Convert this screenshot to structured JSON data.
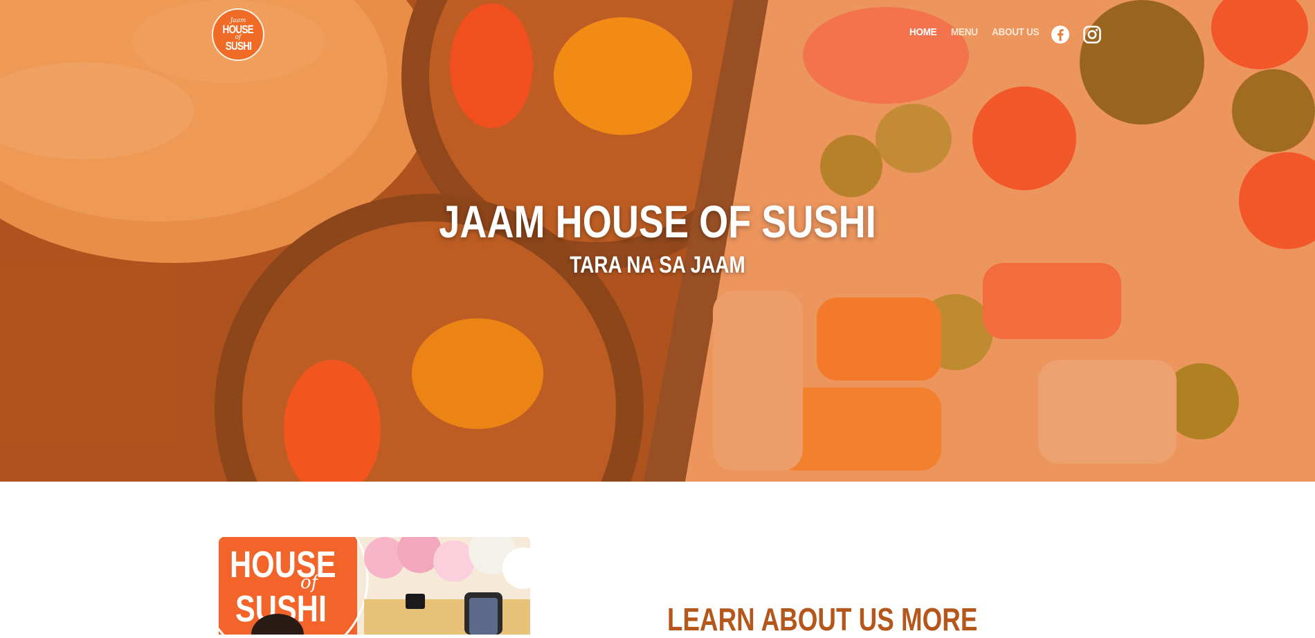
{
  "brand": {
    "logo_text_top": "Jaam",
    "logo_text_line1": "HOUSE",
    "logo_text_line2": "of",
    "logo_text_line3": "SUSHI"
  },
  "nav": {
    "items": [
      {
        "label": "HOME",
        "active": true
      },
      {
        "label": "MENU",
        "active": false
      },
      {
        "label": "ABOUT US",
        "active": false
      }
    ]
  },
  "social": {
    "icons": [
      "facebook-icon",
      "instagram-icon"
    ]
  },
  "hero": {
    "title": "JAAM HOUSE OF SUSHI",
    "subtitle": "TARA NA SA JAAM"
  },
  "about": {
    "heading": "LEARN ABOUT US MORE",
    "photo_sign_line1": "HOUSE",
    "photo_sign_line2": "of",
    "photo_sign_line3": "SUSHI"
  },
  "colors": {
    "overlay": "#e86e26",
    "accent": "#b5561a",
    "logo_bg": "#ef6b26"
  }
}
